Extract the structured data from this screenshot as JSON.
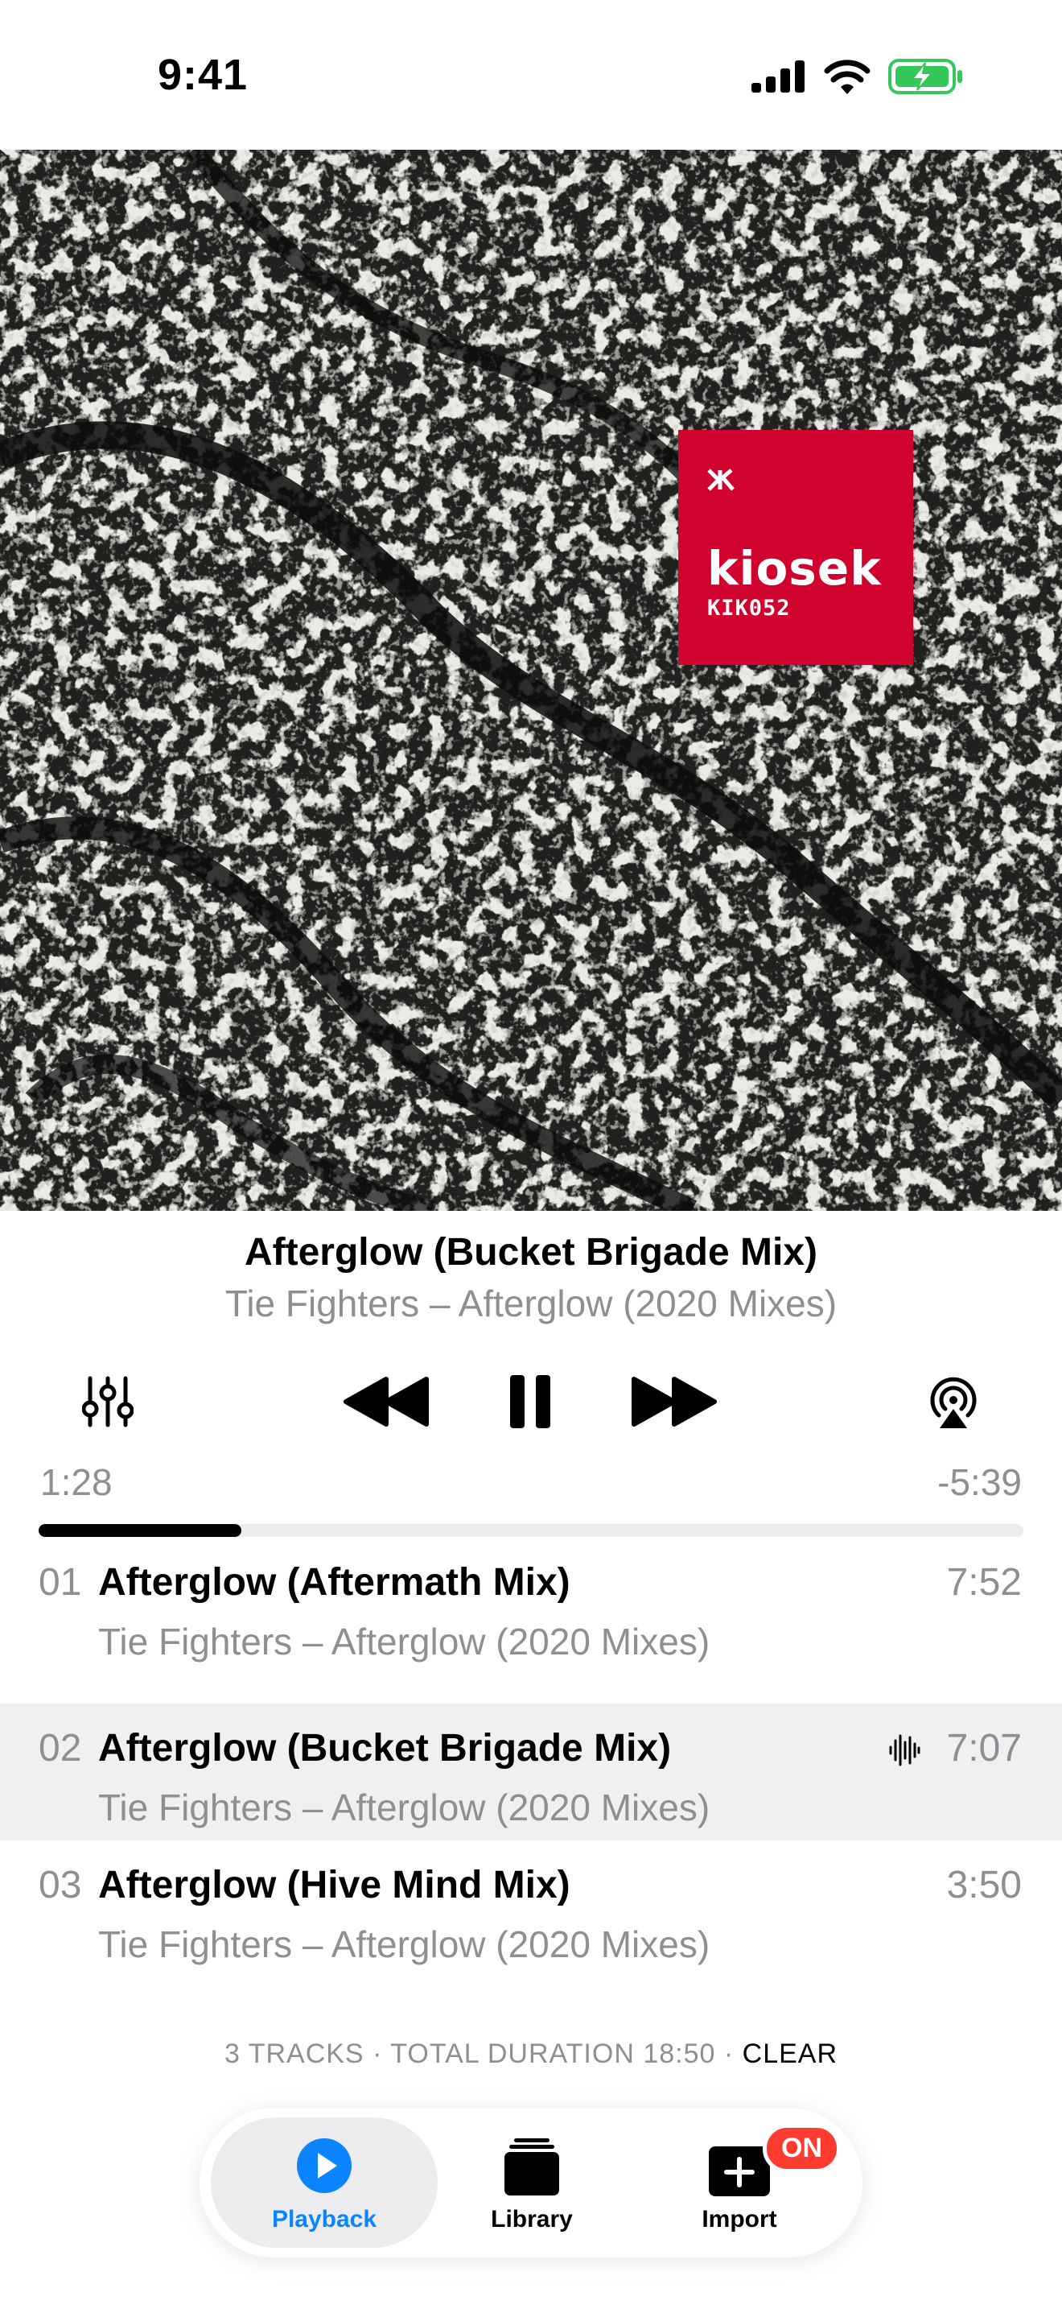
{
  "status_bar": {
    "time": "9:41"
  },
  "artwork": {
    "label_brand": "kiosek",
    "label_catalog": "KIK052",
    "accent_color": "#d0032f"
  },
  "now_playing": {
    "title": "Afterglow (Bucket Brigade Mix)",
    "subtitle": "Tie Fighters – Afterglow (2020 Mixes)",
    "elapsed": "1:28",
    "remaining": "-5:39",
    "progress_fraction": 0.206
  },
  "controls": {
    "equalizer_icon": "sliders-icon",
    "rewind_icon": "rewind-icon",
    "pause_icon": "pause-icon",
    "forward_icon": "fast-forward-icon",
    "airplay_icon": "airplay-icon"
  },
  "queue": {
    "tracks": [
      {
        "number": "01",
        "title": "Afterglow (Aftermath Mix)",
        "artist": "Tie Fighters – Afterglow (2020 Mixes)",
        "duration": "7:52",
        "playing": false
      },
      {
        "number": "02",
        "title": "Afterglow (Bucket Brigade Mix)",
        "artist": "Tie Fighters – Afterglow (2020 Mixes)",
        "duration": "7:07",
        "playing": true
      },
      {
        "number": "03",
        "title": "Afterglow (Hive Mind Mix)",
        "artist": "Tie Fighters – Afterglow (2020 Mixes)",
        "duration": "3:50",
        "playing": false
      }
    ],
    "summary_count": "3 TRACKS",
    "summary_separator": "·",
    "summary_duration": "TOTAL DURATION 18:50",
    "clear_label": "CLEAR"
  },
  "tab_bar": {
    "tabs": [
      {
        "label": "Playback",
        "icon": "play-circle-icon",
        "selected": true
      },
      {
        "label": "Library",
        "icon": "stack-icon",
        "selected": false
      },
      {
        "label": "Import",
        "icon": "plus-square-icon",
        "selected": false
      }
    ],
    "import_badge": "ON",
    "accent_color": "#0a84ff"
  }
}
